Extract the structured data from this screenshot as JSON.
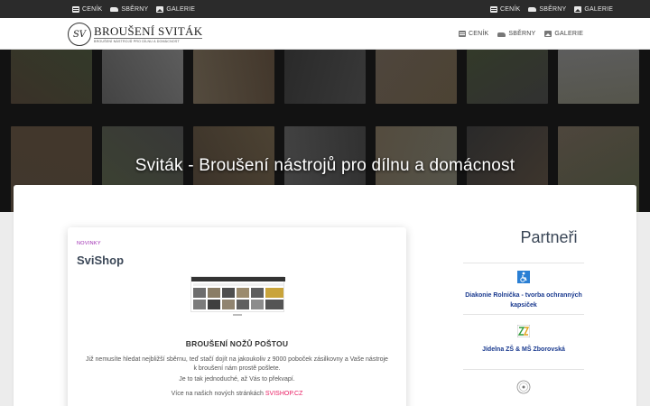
{
  "topbar": {
    "left": [
      {
        "label": "CENÍK",
        "icon": "pricelist-icon"
      },
      {
        "label": "SBĚRNY",
        "icon": "car-icon"
      },
      {
        "label": "GALERIE",
        "icon": "gallery-icon"
      }
    ],
    "right": [
      {
        "label": "CENÍK",
        "icon": "pricelist-icon"
      },
      {
        "label": "SBĚRNY",
        "icon": "car-icon"
      },
      {
        "label": "GALERIE",
        "icon": "gallery-icon"
      }
    ]
  },
  "header": {
    "logo_title": "BROUŠENÍ SVITÁK",
    "logo_subtitle": "BROUŠENÍ NÁSTROJŮ PRO DÍLNU A DOMÁCNOST",
    "nav": [
      {
        "label": "CENÍK",
        "icon": "pricelist-icon"
      },
      {
        "label": "SBĚRNY",
        "icon": "car-icon"
      },
      {
        "label": "GALERIE",
        "icon": "gallery-icon"
      }
    ]
  },
  "hero": {
    "title": "Sviták -  Broušení nástrojů pro dílnu a domácnost"
  },
  "post": {
    "category": "NOVINKY",
    "title": "SviShop",
    "heading": "BROUŠENÍ NOŽŮ POŠTOU",
    "p1": "Již nemusíte hledat nejbližší sběrnu, teď stačí dojít na jakoukoliv z 9000 poboček zásilkovny a Vaše nástroje k broušení nám prostě pošlete.",
    "p2": "Je to tak jednoduché, až Vás to překvapí.",
    "p3_text": "Více na našich nových stránkách ",
    "p3_link": "SVISHOP.CZ"
  },
  "sidebar": {
    "title": "Partneři",
    "partners": [
      {
        "name": "Diakonie Rolnička - tvorba ochranných kapsiček",
        "icon": "wheelchair-icon"
      },
      {
        "name": "Jídelna ZŠ & MŠ Zborovská",
        "icon": "school-logo-icon"
      },
      {
        "name": "",
        "icon": "seal-logo-icon"
      }
    ]
  },
  "colors": {
    "topbar_bg": "#2b2b2b",
    "accent_pink": "#e91e63",
    "category_purple": "#9c27b0",
    "partner_blue": "#1a3a8f"
  }
}
